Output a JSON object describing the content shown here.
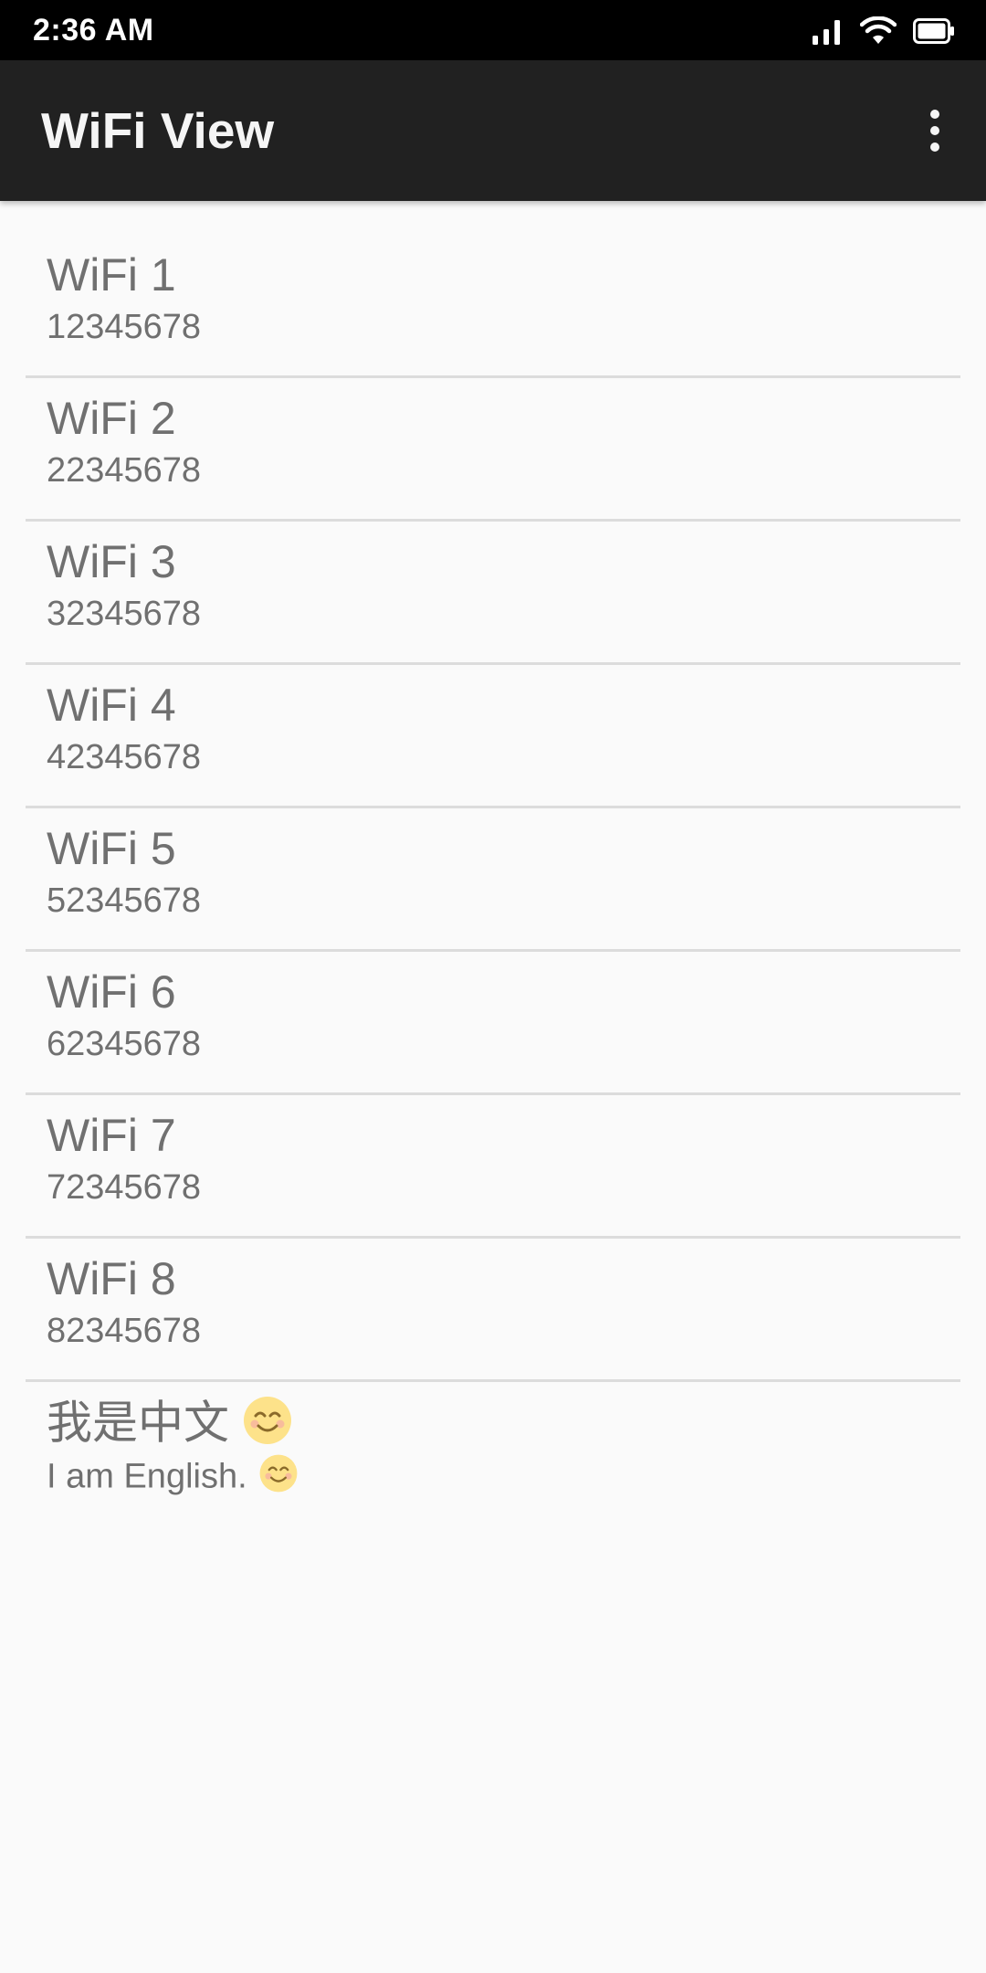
{
  "status_bar": {
    "time": "2:36 AM",
    "icons": [
      "signal-icon",
      "wifi-icon",
      "battery-icon"
    ]
  },
  "app_bar": {
    "title": "WiFi View",
    "overflow_icon": "more-vert-icon"
  },
  "wifi_list": [
    {
      "title": "WiFi 1",
      "subtitle": "12345678"
    },
    {
      "title": "WiFi 2",
      "subtitle": "22345678"
    },
    {
      "title": "WiFi 3",
      "subtitle": "32345678"
    },
    {
      "title": "WiFi 4",
      "subtitle": "42345678"
    },
    {
      "title": "WiFi 5",
      "subtitle": "52345678"
    },
    {
      "title": "WiFi 6",
      "subtitle": "62345678"
    },
    {
      "title": "WiFi 7",
      "subtitle": "72345678"
    },
    {
      "title": "WiFi 8",
      "subtitle": "82345678"
    },
    {
      "title": "我是中文",
      "subtitle": "I am English.",
      "emoji": "smiling-face-icon"
    }
  ],
  "colors": {
    "status_bar": "#000000",
    "app_bar": "#212121",
    "background": "#fafafa",
    "text": "#707070",
    "divider": "#dcdcdc"
  }
}
